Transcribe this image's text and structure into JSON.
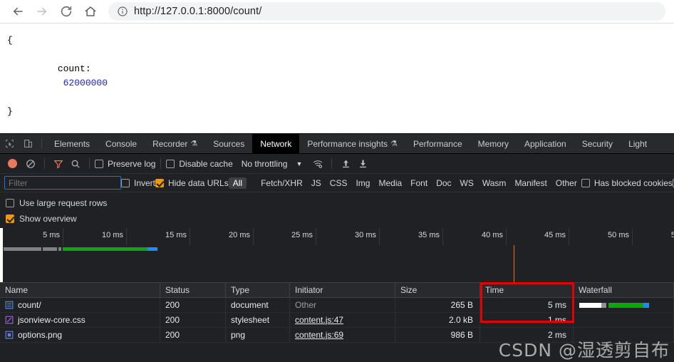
{
  "browser": {
    "back_label": "Back",
    "forward_label": "Forward",
    "reload_label": "Reload",
    "home_label": "Home",
    "site_info_label": "View site information",
    "url": "http://127.0.0.1:8000/count/"
  },
  "page": {
    "open_brace": "{",
    "close_brace": "}",
    "key": "count:",
    "value": "62000000"
  },
  "devtools": {
    "tabs": [
      {
        "label": "Elements",
        "active": false,
        "flask": false
      },
      {
        "label": "Console",
        "active": false,
        "flask": false
      },
      {
        "label": "Recorder",
        "active": false,
        "flask": true
      },
      {
        "label": "Sources",
        "active": false,
        "flask": false
      },
      {
        "label": "Network",
        "active": true,
        "flask": false
      },
      {
        "label": "Performance insights",
        "active": false,
        "flask": true
      },
      {
        "label": "Performance",
        "active": false,
        "flask": false
      },
      {
        "label": "Memory",
        "active": false,
        "flask": false
      },
      {
        "label": "Application",
        "active": false,
        "flask": false
      },
      {
        "label": "Security",
        "active": false,
        "flask": false
      },
      {
        "label": "Light",
        "active": false,
        "flask": false
      }
    ],
    "flask_glyph": "⚗",
    "toolbar": {
      "record_label": "Stop recording network log",
      "clear_label": "Clear network log",
      "filter_label": "Filter",
      "search_label": "Search",
      "preserve_log_label": "Preserve log",
      "preserve_log_checked": false,
      "disable_cache_label": "Disable cache",
      "disable_cache_checked": false,
      "throttling_value": "No throttling",
      "throttling_caret": "▼",
      "network_conditions_label": "Network conditions",
      "import_har_label": "Import HAR file",
      "export_har_label": "Export HAR file"
    },
    "filterbar": {
      "filter_placeholder": "Filter",
      "filter_value": "",
      "invert_label": "Invert",
      "invert_checked": false,
      "hide_data_urls_label": "Hide data URLs",
      "hide_data_urls_checked": true,
      "types": [
        "All",
        "Fetch/XHR",
        "JS",
        "CSS",
        "Img",
        "Media",
        "Font",
        "Doc",
        "WS",
        "Wasm",
        "Manifest",
        "Other"
      ],
      "selected_type": "All",
      "has_blocked_cookies_label": "Has blocked cookies",
      "has_blocked_cookies_checked": false
    },
    "settings": {
      "large_rows_label": "Use large request rows",
      "large_rows_checked": false,
      "show_overview_label": "Show overview",
      "show_overview_checked": true
    },
    "overview": {
      "ticks": [
        "5 ms",
        "10 ms",
        "15 ms",
        "20 ms",
        "25 ms",
        "30 ms",
        "35 ms",
        "40 ms",
        "45 ms",
        "50 ms",
        "5"
      ],
      "marker_color": "#ef6c00",
      "bar_colors": {
        "waiting": "#7f8184",
        "download": "#0fa50f",
        "end": "#1a8cff"
      }
    },
    "table": {
      "columns": [
        "Name",
        "Status",
        "Type",
        "Initiator",
        "Size",
        "Time",
        "Waterfall"
      ],
      "rows": [
        {
          "name": "count/",
          "icon": "document-icon",
          "status": "200",
          "type": "document",
          "initiator": "Other",
          "initiator_is_link": false,
          "size": "265 B",
          "time": "5 ms"
        },
        {
          "name": "jsonview-core.css",
          "icon": "stylesheet-icon",
          "status": "200",
          "type": "stylesheet",
          "initiator": "content.js:47",
          "initiator_is_link": true,
          "size": "2.0 kB",
          "time": "1 ms"
        },
        {
          "name": "options.png",
          "icon": "image-icon",
          "status": "200",
          "type": "png",
          "initiator": "content.js:69",
          "initiator_is_link": true,
          "size": "986 B",
          "time": "2 ms"
        }
      ]
    },
    "annotation": {
      "highlight_color": "#e60000",
      "highlight_target": "Time column"
    }
  },
  "watermark": "CSDN @湿透剪自布"
}
